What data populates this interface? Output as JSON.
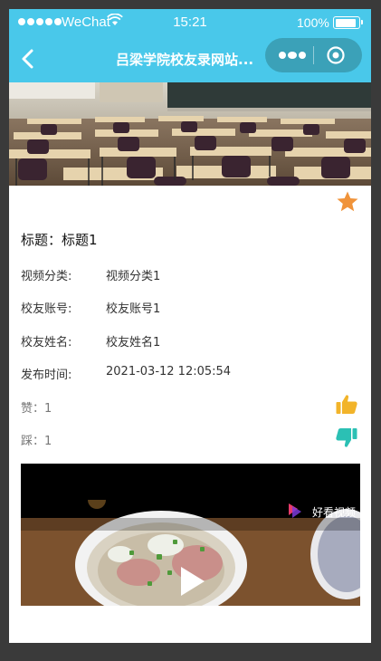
{
  "status_bar": {
    "carrier": "WeChat",
    "time": "15:21",
    "battery": "100%"
  },
  "nav": {
    "title": "吕梁学院校友录网站..."
  },
  "detail": {
    "title_label": "标题：",
    "title_value": "标题1",
    "rows": [
      {
        "label": "视频分类:",
        "value": "视频分类1"
      },
      {
        "label": "校友账号:",
        "value": "校友账号1"
      },
      {
        "label": "校友姓名:",
        "value": "校友姓名1"
      },
      {
        "label": "发布时间:",
        "value": "2021-03-12 12:05:54"
      }
    ],
    "likes_label": "赞：",
    "likes_value": "1",
    "dislikes_label": "踩：",
    "dislikes_value": "1"
  },
  "video": {
    "watermark": "好看视频"
  },
  "colors": {
    "accent": "#49c8ea",
    "capsule": "#3ba1b8",
    "star": "#f0933a",
    "like": "#f2b42a",
    "dislike": "#2bc0b4"
  },
  "icons": {
    "back": "chevron-left-icon",
    "more": "more-dots-icon",
    "close": "target-close-icon",
    "favorite": "star-icon",
    "like": "thumbs-up-icon",
    "dislike": "thumbs-down-icon",
    "play": "play-icon"
  }
}
